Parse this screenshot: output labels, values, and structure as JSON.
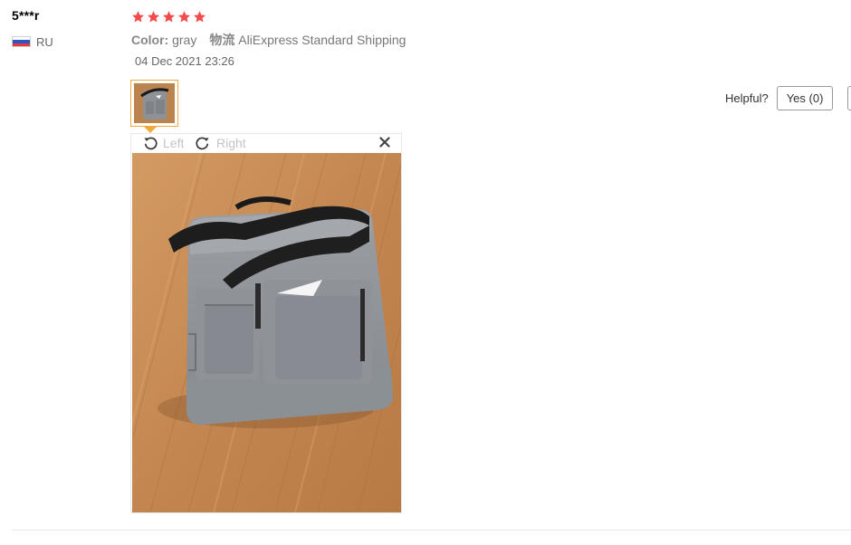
{
  "review": {
    "user": {
      "name": "5***r",
      "country": "RU",
      "flag_colors": [
        "#ffffff",
        "#2c56c4",
        "#e03a3a"
      ]
    },
    "rating": {
      "stars": 5,
      "max_stars": 5,
      "star_color": "#f44a4a",
      "star_glyph": "★"
    },
    "meta": {
      "color_label": "Color:",
      "color_value": "gray",
      "logistics_label": "物流",
      "logistics_value": "AliExpress Standard Shipping"
    },
    "date": "04 Dec 2021 23:26",
    "thumbnail": {
      "icon": "photo-thumbnail",
      "selected_border_color": "#f2a93c"
    },
    "viewer": {
      "rotate_left_label": "Left",
      "rotate_right_label": "Right",
      "close_glyph": "×"
    },
    "helpful": {
      "label": "Helpful?",
      "yes_label": "Yes (0)"
    }
  }
}
